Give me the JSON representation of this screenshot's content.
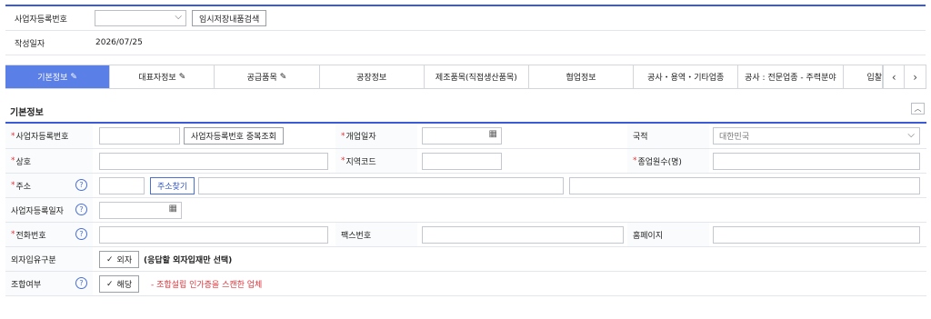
{
  "top": {
    "biz_no_label": "사업자등록번호",
    "temp_search_button": "임시저장내품검색",
    "date_label": "작성일자",
    "date_value": "2026/07/25"
  },
  "tabs": [
    {
      "label": "기본정보",
      "edit": true,
      "active": true
    },
    {
      "label": "대표자정보",
      "edit": true,
      "active": false
    },
    {
      "label": "공급품목",
      "edit": true,
      "active": false
    },
    {
      "label": "공장정보",
      "edit": false,
      "active": false
    },
    {
      "label": "제조품목(직접생산품목)",
      "edit": false,
      "active": false
    },
    {
      "label": "협업정보",
      "edit": false,
      "active": false
    },
    {
      "label": "공사・용역・기타업종",
      "edit": false,
      "active": false
    },
    {
      "label": "공사 : 전문업종 - 주력분야",
      "edit": false,
      "active": false
    },
    {
      "label": "입찰",
      "edit": false,
      "active": false
    }
  ],
  "icons": {
    "edit": "pencil-icon",
    "prev": "chevron-left-icon",
    "next": "chevron-right-icon",
    "help": "question-icon",
    "calendar": "calendar-icon",
    "check": "check-icon"
  },
  "section": {
    "title": "기본정보"
  },
  "form": {
    "biz_no_label": "사업자등록번호",
    "dup_check_button": "사업자등록번호 중복조회",
    "open_date_label": "개업일자",
    "country_label": "국적",
    "country_value": "대한민국",
    "trade_name_label": "상호",
    "region_code_label": "지역코드",
    "employees_label": "종업원수(명)",
    "address_label": "주소",
    "address_search_button": "주소찾기",
    "biz_reg_date_label": "사업자등록일자",
    "phone_label": "전화번호",
    "fax_label": "팩스번호",
    "homepage_label": "홈페이지",
    "foreign_type_label": "외자입유구분",
    "foreign_button": "외자",
    "foreign_note": "(응답할 외자입재만 선택)",
    "union_label": "조합여부",
    "union_button": "해당",
    "union_note": "- 조합설립 인가증을 스캔한 업체"
  },
  "colors": {
    "accent": "#3b5bd6",
    "active_tab": "#5a7fe6",
    "required": "#e0333a"
  }
}
